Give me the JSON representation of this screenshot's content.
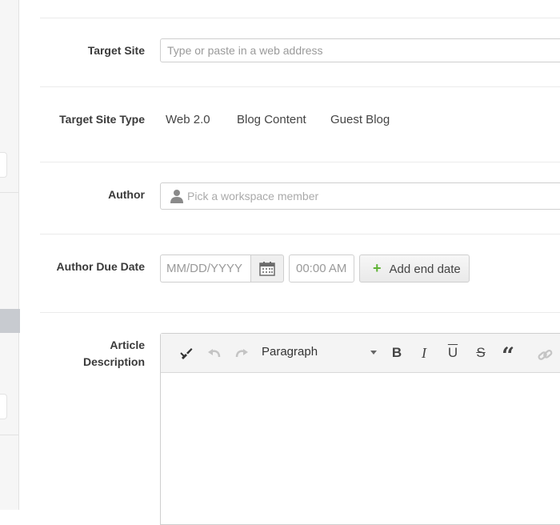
{
  "form": {
    "target_site": {
      "label": "Target Site",
      "placeholder": "Type or paste in a web address"
    },
    "target_site_type": {
      "label": "Target Site Type",
      "options": [
        "Web 2.0",
        "Blog Content",
        "Guest Blog"
      ]
    },
    "author": {
      "label": "Author",
      "placeholder": "Pick a workspace member",
      "icon": "person-icon"
    },
    "author_due_date": {
      "label": "Author Due Date",
      "date_placeholder": "MM/DD/YYYY",
      "time_placeholder": "00:00 AM",
      "add_end_date": "Add end date",
      "calendar_icon": "calendar-icon"
    },
    "article_description": {
      "label_line1": "Article",
      "label_line2": "Description",
      "toolbar": {
        "format_value": "Paragraph",
        "icons": [
          "clear-format-icon",
          "undo-icon",
          "redo-icon",
          "bold-icon",
          "italic-icon",
          "underline-icon",
          "strikethrough-icon",
          "quote-icon",
          "link-icon"
        ],
        "bold_glyph": "B",
        "italic_glyph": "I",
        "underline_glyph": "U",
        "strike_glyph": "S",
        "quote_glyph": "“"
      }
    }
  },
  "colors": {
    "accent_plus": "#5fb336",
    "border": "#cfcfcf",
    "label_text": "#3a3a3a"
  }
}
